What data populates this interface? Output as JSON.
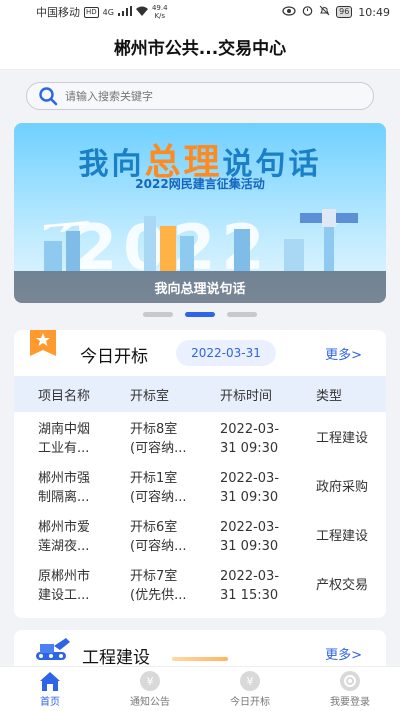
{
  "status_bar": {
    "carrier": "中国移动",
    "network_badge": "HD",
    "network_type": "4G",
    "speed_value": "49.4",
    "speed_unit": "K/s",
    "battery": "96",
    "time": "10:49"
  },
  "header": {
    "title": "郴州市公共...交易中心"
  },
  "search": {
    "placeholder": "请输入搜索关键字"
  },
  "banner": {
    "headline_part1": "我向",
    "headline_accent": "总理",
    "headline_part2": "说句话",
    "subheadline": "2022网民建言征集活动",
    "year_art": "2022",
    "caption": "我向总理说句话"
  },
  "carousel": {
    "total": 3,
    "active_index": 1
  },
  "today_bids": {
    "title": "今日开标",
    "date": "2022-03-31",
    "more": "更多>",
    "columns": [
      "项目名称",
      "开标室",
      "开标时间",
      "类型"
    ],
    "rows": [
      {
        "name": "湖南中烟\n工业有...",
        "room": "开标8室\n(可容纳...",
        "time": "2022-03-\n31 09:30",
        "type": "工程建设"
      },
      {
        "name": "郴州市强\n制隔离...",
        "room": "开标1室\n(可容纳...",
        "time": "2022-03-\n31 09:30",
        "type": "政府采购"
      },
      {
        "name": "郴州市爱\n莲湖夜...",
        "room": "开标6室\n(可容纳...",
        "time": "2022-03-\n31 09:30",
        "type": "工程建设"
      },
      {
        "name": "原郴州市\n建设工...",
        "room": "开标7室\n(优先供...",
        "time": "2022-03-\n31 15:30",
        "type": "产权交易"
      }
    ]
  },
  "engineering": {
    "title": "工程建设",
    "more": "更多>"
  },
  "tabbar": {
    "items": [
      {
        "label": "首页",
        "icon": "home-icon",
        "active": true
      },
      {
        "label": "通知公告",
        "icon": "notice-icon",
        "active": false
      },
      {
        "label": "今日开标",
        "icon": "bid-icon",
        "active": false
      },
      {
        "label": "我要登录",
        "icon": "login-icon",
        "active": false
      }
    ]
  },
  "colors": {
    "accent": "#2e64e8",
    "header_row": "#e8effc",
    "orange": "#ff8a1f"
  }
}
